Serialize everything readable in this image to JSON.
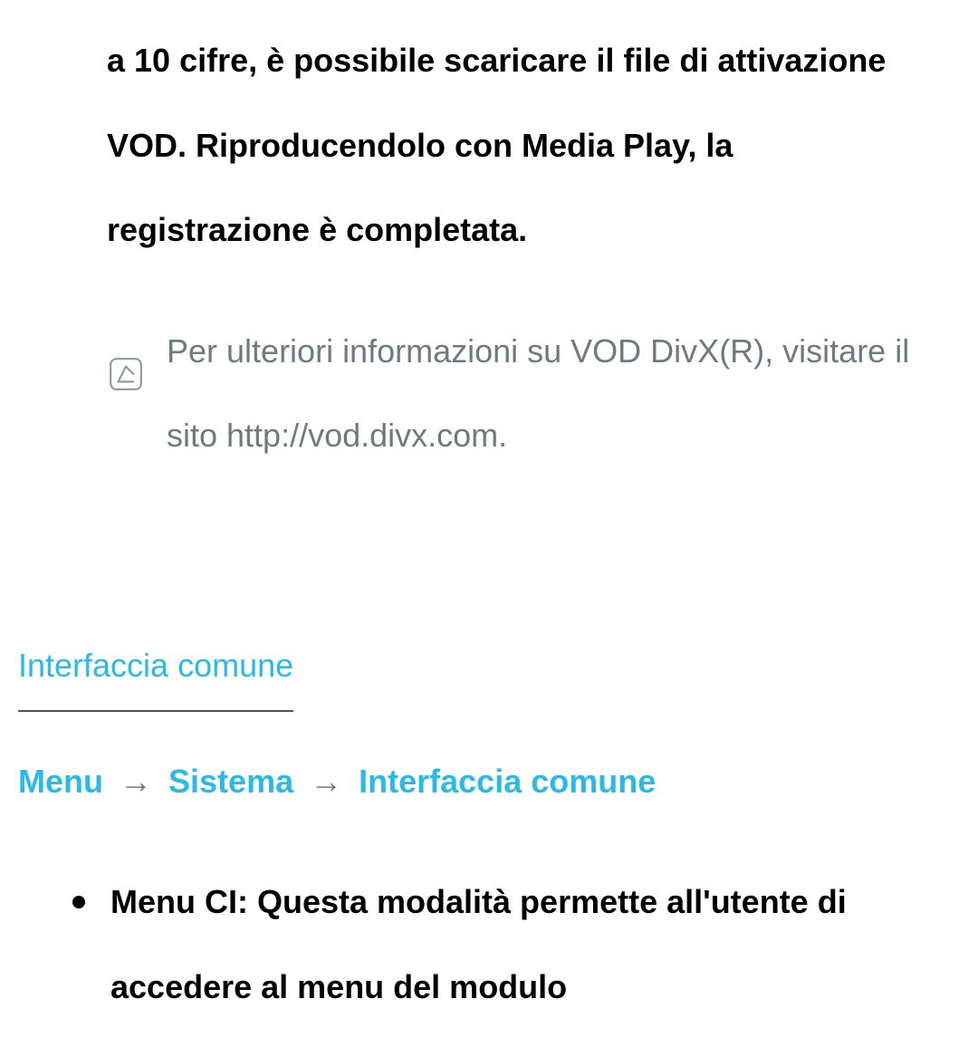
{
  "paragraph1": "a 10 cifre, è possibile scaricare il file di attivazione VOD. Riproducendolo con Media Play, la registrazione è completata.",
  "note_text": "Per ulteriori informazioni su VOD DivX(R), visitare il sito http://vod.divx.com.",
  "section_title": "Interfaccia comune",
  "breadcrumb": {
    "item1": "Menu",
    "arrow": "→",
    "item2": "Sistema",
    "item3": "Interfaccia comune"
  },
  "bullet_text": "Menu CI: Questa modalità permette all'utente di accedere al menu del modulo"
}
